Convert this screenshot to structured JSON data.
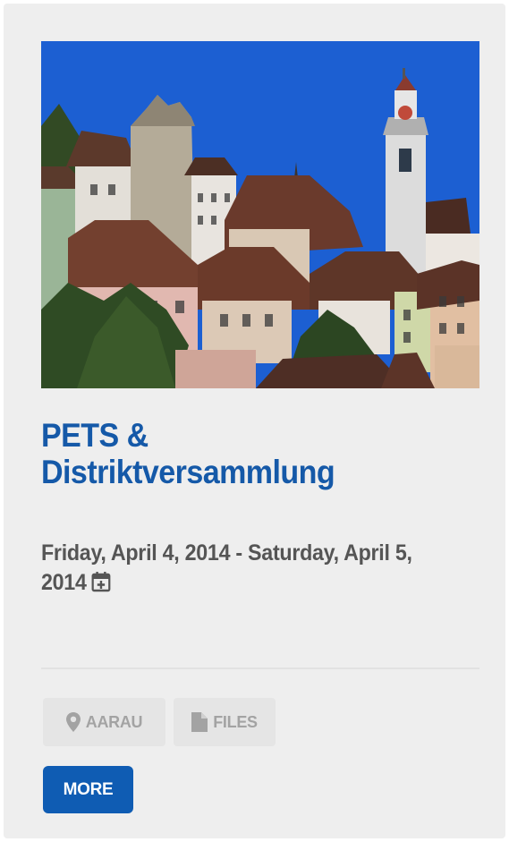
{
  "event": {
    "title": "PETS & Distriktversammlung",
    "dates": "Friday, April 4, 2014 - Saturday, April 5, 2014",
    "image_alt": "Aarau old town with clock tower",
    "tags": {
      "location": "AARAU",
      "files": "FILES"
    },
    "more_label": "MORE"
  },
  "icons": {
    "add_to_calendar": "calendar-plus-icon",
    "location": "map-marker-icon",
    "files": "file-icon"
  },
  "colors": {
    "title": "#1559a8",
    "button": "#0f5cb3",
    "sky": "#1c5fd2",
    "card_bg": "#eeeeee"
  }
}
